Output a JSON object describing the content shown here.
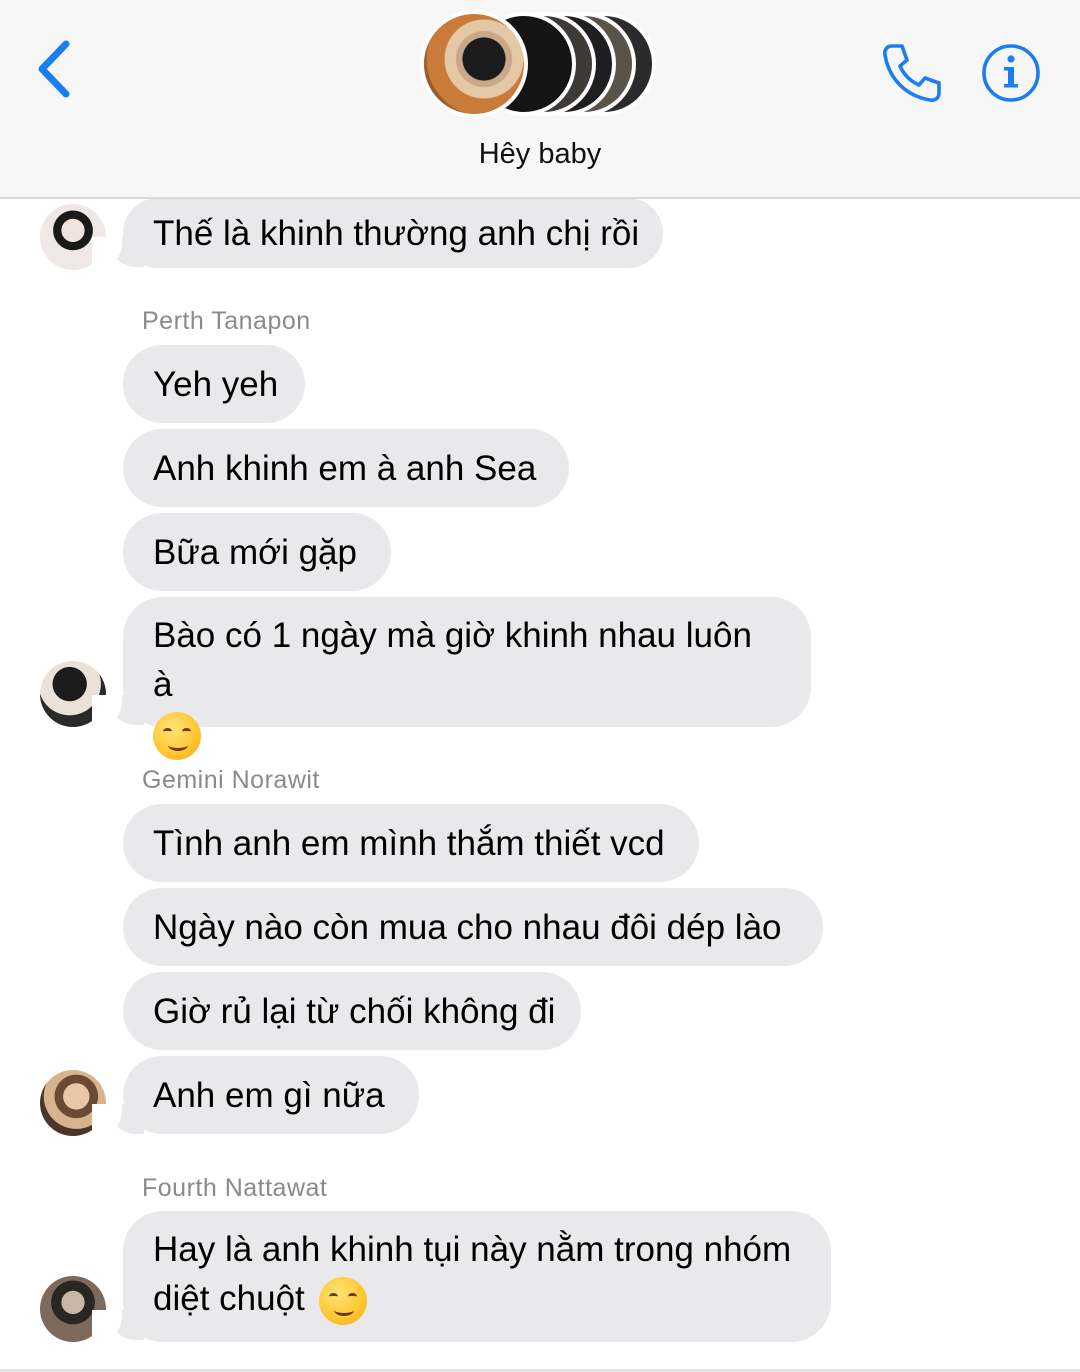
{
  "header": {
    "group_title": "Hêy baby",
    "back_icon": "chevron-left-icon",
    "call_icon": "phone-icon",
    "info_icon": "info-icon",
    "accent_color": "#1a7ef2"
  },
  "messages": [
    {
      "text": "Thế là khinh thường anh chị rồi"
    },
    {
      "sender": "Perth Tanapon"
    },
    {
      "text": "Yeh yeh"
    },
    {
      "text": "Anh khinh em à anh Sea"
    },
    {
      "text": "Bữa mới gặp"
    },
    {
      "text": "Bào có 1 ngày mà giờ khinh nhau luôn à",
      "emoji": "smirking-face"
    },
    {
      "sender": "Gemini Norawit"
    },
    {
      "text": "Tình anh em mình thắm thiết vcd"
    },
    {
      "text": "Ngày nào còn mua cho nhau đôi dép lào"
    },
    {
      "text": "Giờ rủ lại từ chối không đi"
    },
    {
      "text": "Anh em gì nữa"
    },
    {
      "sender": "Fourth Nattawat"
    },
    {
      "text_line1": "Hay là anh khinh tụi này nằm trong nhóm",
      "text_line2": "diệt chuột",
      "emoji": "smirking-face"
    }
  ],
  "colors": {
    "bubble": "#e9e9eb",
    "sender_name": "#8a8a8e",
    "header_bg": "#f7f7f8"
  }
}
